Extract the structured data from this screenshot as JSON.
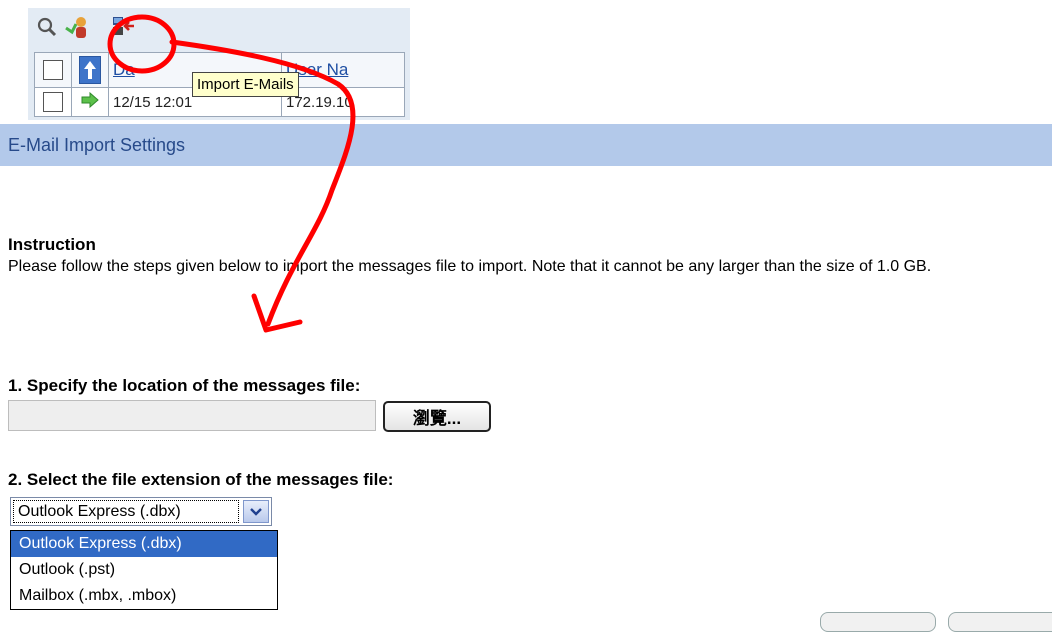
{
  "toolbar": {
    "icons": [
      "search-icon",
      "user-import-icon",
      "import-emails-icon"
    ]
  },
  "table": {
    "headers": [
      "Da",
      "User Na"
    ],
    "rows": [
      [
        "12/15 12:01",
        "172.19.10"
      ]
    ]
  },
  "tooltip": {
    "text": "Import E-Mails"
  },
  "panel": {
    "title": "E-Mail Import Settings",
    "instruction_heading": "Instruction",
    "instruction_text": "Please follow the steps given below to import the messages file to import. Note that it cannot be any larger than the size of 1.0 GB.",
    "step1_label": "1. Specify the location of the messages file:",
    "file_input_value": "",
    "browse_label": "瀏覽...",
    "step2_label": "2. Select the file extension of the messages file:",
    "selected_extension": "Outlook Express (.dbx)",
    "extension_options": [
      "Outlook Express (.dbx)",
      "Outlook (.pst)",
      "Mailbox (.mbx, .mbox)"
    ]
  },
  "colors": {
    "title_bar": "#b3c9ea",
    "title_text": "#274a8a",
    "selection": "#316ac5",
    "annotation": "#ff0000",
    "tooltip_bg": "#ffffcc"
  }
}
